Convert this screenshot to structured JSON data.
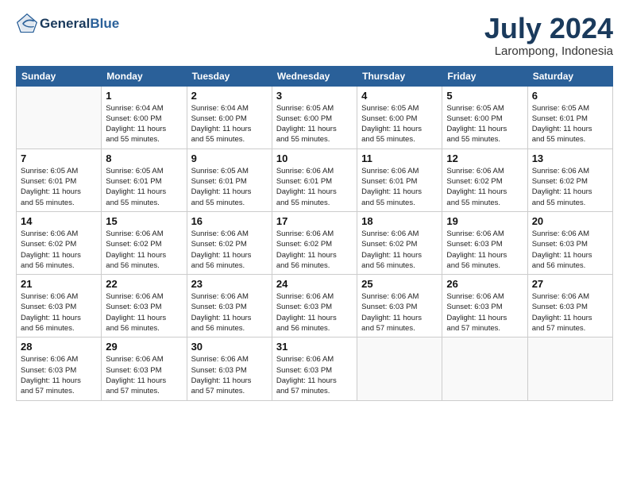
{
  "header": {
    "logo_general": "General",
    "logo_blue": "Blue",
    "month_year": "July 2024",
    "location": "Larompong, Indonesia"
  },
  "weekdays": [
    "Sunday",
    "Monday",
    "Tuesday",
    "Wednesday",
    "Thursday",
    "Friday",
    "Saturday"
  ],
  "weeks": [
    [
      {
        "day": "",
        "info": ""
      },
      {
        "day": "1",
        "info": "Sunrise: 6:04 AM\nSunset: 6:00 PM\nDaylight: 11 hours\nand 55 minutes."
      },
      {
        "day": "2",
        "info": "Sunrise: 6:04 AM\nSunset: 6:00 PM\nDaylight: 11 hours\nand 55 minutes."
      },
      {
        "day": "3",
        "info": "Sunrise: 6:05 AM\nSunset: 6:00 PM\nDaylight: 11 hours\nand 55 minutes."
      },
      {
        "day": "4",
        "info": "Sunrise: 6:05 AM\nSunset: 6:00 PM\nDaylight: 11 hours\nand 55 minutes."
      },
      {
        "day": "5",
        "info": "Sunrise: 6:05 AM\nSunset: 6:00 PM\nDaylight: 11 hours\nand 55 minutes."
      },
      {
        "day": "6",
        "info": "Sunrise: 6:05 AM\nSunset: 6:01 PM\nDaylight: 11 hours\nand 55 minutes."
      }
    ],
    [
      {
        "day": "7",
        "info": "Sunrise: 6:05 AM\nSunset: 6:01 PM\nDaylight: 11 hours\nand 55 minutes."
      },
      {
        "day": "8",
        "info": "Sunrise: 6:05 AM\nSunset: 6:01 PM\nDaylight: 11 hours\nand 55 minutes."
      },
      {
        "day": "9",
        "info": "Sunrise: 6:05 AM\nSunset: 6:01 PM\nDaylight: 11 hours\nand 55 minutes."
      },
      {
        "day": "10",
        "info": "Sunrise: 6:06 AM\nSunset: 6:01 PM\nDaylight: 11 hours\nand 55 minutes."
      },
      {
        "day": "11",
        "info": "Sunrise: 6:06 AM\nSunset: 6:01 PM\nDaylight: 11 hours\nand 55 minutes."
      },
      {
        "day": "12",
        "info": "Sunrise: 6:06 AM\nSunset: 6:02 PM\nDaylight: 11 hours\nand 55 minutes."
      },
      {
        "day": "13",
        "info": "Sunrise: 6:06 AM\nSunset: 6:02 PM\nDaylight: 11 hours\nand 55 minutes."
      }
    ],
    [
      {
        "day": "14",
        "info": "Sunrise: 6:06 AM\nSunset: 6:02 PM\nDaylight: 11 hours\nand 56 minutes."
      },
      {
        "day": "15",
        "info": "Sunrise: 6:06 AM\nSunset: 6:02 PM\nDaylight: 11 hours\nand 56 minutes."
      },
      {
        "day": "16",
        "info": "Sunrise: 6:06 AM\nSunset: 6:02 PM\nDaylight: 11 hours\nand 56 minutes."
      },
      {
        "day": "17",
        "info": "Sunrise: 6:06 AM\nSunset: 6:02 PM\nDaylight: 11 hours\nand 56 minutes."
      },
      {
        "day": "18",
        "info": "Sunrise: 6:06 AM\nSunset: 6:02 PM\nDaylight: 11 hours\nand 56 minutes."
      },
      {
        "day": "19",
        "info": "Sunrise: 6:06 AM\nSunset: 6:03 PM\nDaylight: 11 hours\nand 56 minutes."
      },
      {
        "day": "20",
        "info": "Sunrise: 6:06 AM\nSunset: 6:03 PM\nDaylight: 11 hours\nand 56 minutes."
      }
    ],
    [
      {
        "day": "21",
        "info": "Sunrise: 6:06 AM\nSunset: 6:03 PM\nDaylight: 11 hours\nand 56 minutes."
      },
      {
        "day": "22",
        "info": "Sunrise: 6:06 AM\nSunset: 6:03 PM\nDaylight: 11 hours\nand 56 minutes."
      },
      {
        "day": "23",
        "info": "Sunrise: 6:06 AM\nSunset: 6:03 PM\nDaylight: 11 hours\nand 56 minutes."
      },
      {
        "day": "24",
        "info": "Sunrise: 6:06 AM\nSunset: 6:03 PM\nDaylight: 11 hours\nand 56 minutes."
      },
      {
        "day": "25",
        "info": "Sunrise: 6:06 AM\nSunset: 6:03 PM\nDaylight: 11 hours\nand 57 minutes."
      },
      {
        "day": "26",
        "info": "Sunrise: 6:06 AM\nSunset: 6:03 PM\nDaylight: 11 hours\nand 57 minutes."
      },
      {
        "day": "27",
        "info": "Sunrise: 6:06 AM\nSunset: 6:03 PM\nDaylight: 11 hours\nand 57 minutes."
      }
    ],
    [
      {
        "day": "28",
        "info": "Sunrise: 6:06 AM\nSunset: 6:03 PM\nDaylight: 11 hours\nand 57 minutes."
      },
      {
        "day": "29",
        "info": "Sunrise: 6:06 AM\nSunset: 6:03 PM\nDaylight: 11 hours\nand 57 minutes."
      },
      {
        "day": "30",
        "info": "Sunrise: 6:06 AM\nSunset: 6:03 PM\nDaylight: 11 hours\nand 57 minutes."
      },
      {
        "day": "31",
        "info": "Sunrise: 6:06 AM\nSunset: 6:03 PM\nDaylight: 11 hours\nand 57 minutes."
      },
      {
        "day": "",
        "info": ""
      },
      {
        "day": "",
        "info": ""
      },
      {
        "day": "",
        "info": ""
      }
    ]
  ]
}
